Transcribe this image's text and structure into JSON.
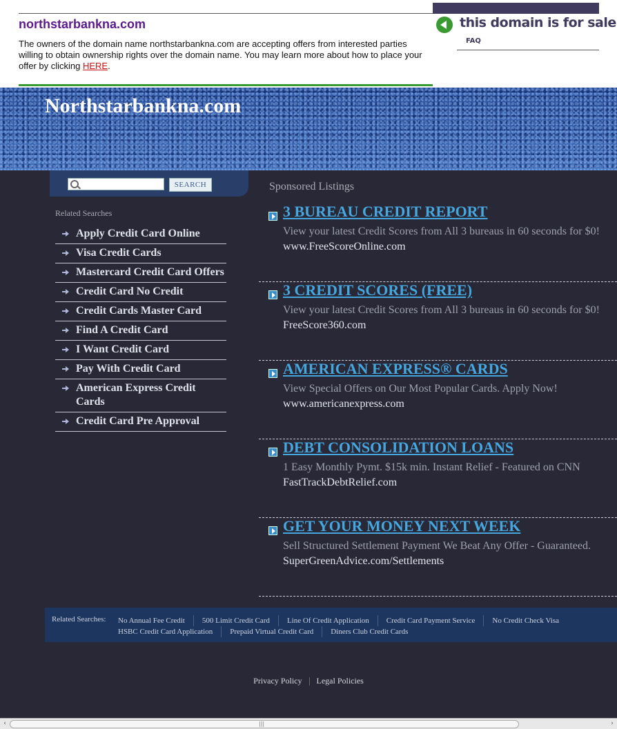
{
  "topbar": {
    "domain": "northstarbankna.com",
    "message": "The owners of the domain name northstarbankna.com are accepting offers from interested parties willing to obtain ownership rights over the domain name. You may learn more about how to place your offer by clicking ",
    "link": "HERE",
    "after_link": ".",
    "for_sale": "this domain is for sale",
    "faq": "FAQ"
  },
  "hero": {
    "title": "Northstarbankna.com"
  },
  "search": {
    "button": "SEARCH",
    "value": ""
  },
  "related": {
    "heading": "Related Searches",
    "items": [
      "Apply Credit Card Online",
      "Visa Credit Cards",
      "Mastercard Credit Card Offers",
      "Credit Card No Credit",
      "Credit Cards Master Card",
      "Find A Credit Card",
      "I Want Credit Card",
      "Pay With Credit Card",
      "American Express Credit Cards",
      "Credit Card Pre Approval"
    ]
  },
  "sponsored": {
    "heading": "Sponsored Listings",
    "listings": [
      {
        "title": "3 BUREAU CREDIT REPORT",
        "desc": "View your latest Credit Scores from All 3 bureaus in 60 seconds for $0!",
        "url": "www.FreeScoreOnline.com"
      },
      {
        "title": "3 CREDIT SCORES (FREE)",
        "desc": "View your latest Credit Scores from All 3 bureaus in 60 seconds for $0!",
        "url": "FreeScore360.com"
      },
      {
        "title": "AMERICAN EXPRESS® CARDS",
        "desc": "View Special Offers on Our Most Popular Cards. Apply Now!",
        "url": "www.americanexpress.com"
      },
      {
        "title": "DEBT CONSOLIDATION LOANS",
        "desc": "1 Easy Monthly Pymt. $15k min. Instant Relief - Featured on CNN",
        "url": "FastTrackDebtRelief.com"
      },
      {
        "title": "GET YOUR MONEY NEXT WEEK",
        "desc": "Sell Structured Settlement Payment We Beat Any Offer - Guaranteed.",
        "url": "SuperGreenAdvice.com/Settlements"
      }
    ]
  },
  "footer_related": {
    "heading": "Related Searches:",
    "links": [
      "No Annual Fee Credit",
      "500 Limit Credit Card",
      "Line Of Credit Application",
      "Credit Card Payment Service",
      "No Credit Check Visa",
      "HSBC Credit Card Application",
      "Prepaid Virtual Credit Card",
      "Diners Club Credit Cards"
    ]
  },
  "footer": {
    "privacy": "Privacy Policy",
    "legal": "Legal Policies"
  },
  "colors": {
    "page_bg": "#282837",
    "link_blue": "#46a6de",
    "hero_blue": "#2c4f9a",
    "domain_purple": "#5b1a8e",
    "green": "#3a9a32"
  },
  "icons": [
    "search-icon",
    "arrow-bullet-icon",
    "play-arrow-icon",
    "back-arrow-icon"
  ]
}
